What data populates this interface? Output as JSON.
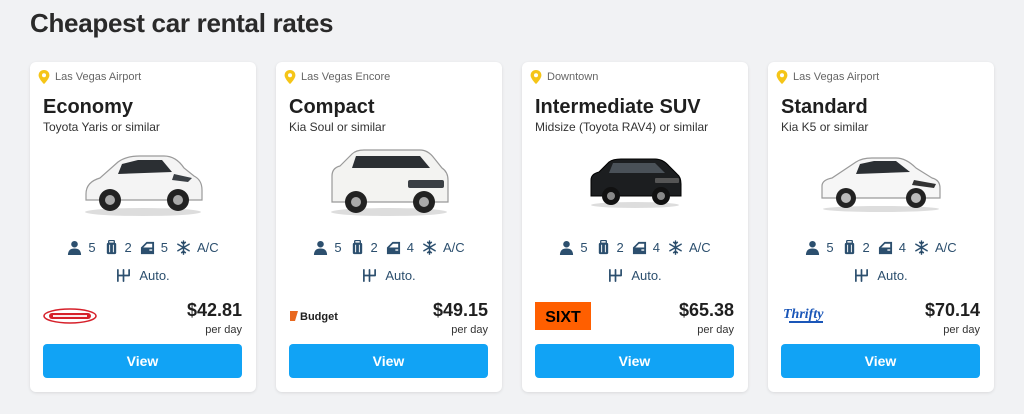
{
  "page_title": "Cheapest car rental rates",
  "colors": {
    "accent": "#11a3f5",
    "pin": "#f5c518",
    "spec": "#2c4f6e"
  },
  "cards": [
    {
      "location": "Las Vegas Airport",
      "class": "Economy",
      "model": "Toyota Yaris or similar",
      "car_color": "white",
      "specs": {
        "passengers": "5",
        "bags": "2",
        "doors": "5",
        "ac": "A/C",
        "transmission": "Auto."
      },
      "supplier": "Easirent",
      "price": "$42.81",
      "per": "per day",
      "button": "View"
    },
    {
      "location": "Las Vegas Encore",
      "class": "Compact",
      "model": "Kia Soul or similar",
      "car_color": "white",
      "specs": {
        "passengers": "5",
        "bags": "2",
        "doors": "4",
        "ac": "A/C",
        "transmission": "Auto."
      },
      "supplier": "Budget",
      "price": "$49.15",
      "per": "per day",
      "button": "View"
    },
    {
      "location": "Downtown",
      "class": "Intermediate SUV",
      "model": "Midsize (Toyota RAV4) or similar",
      "car_color": "black",
      "specs": {
        "passengers": "5",
        "bags": "2",
        "doors": "4",
        "ac": "A/C",
        "transmission": "Auto."
      },
      "supplier": "SIXT",
      "price": "$65.38",
      "per": "per day",
      "button": "View"
    },
    {
      "location": "Las Vegas Airport",
      "class": "Standard",
      "model": "Kia K5 or similar",
      "car_color": "white",
      "specs": {
        "passengers": "5",
        "bags": "2",
        "doors": "4",
        "ac": "A/C",
        "transmission": "Auto."
      },
      "supplier": "Thrifty",
      "price": "$70.14",
      "per": "per day",
      "button": "View"
    }
  ]
}
